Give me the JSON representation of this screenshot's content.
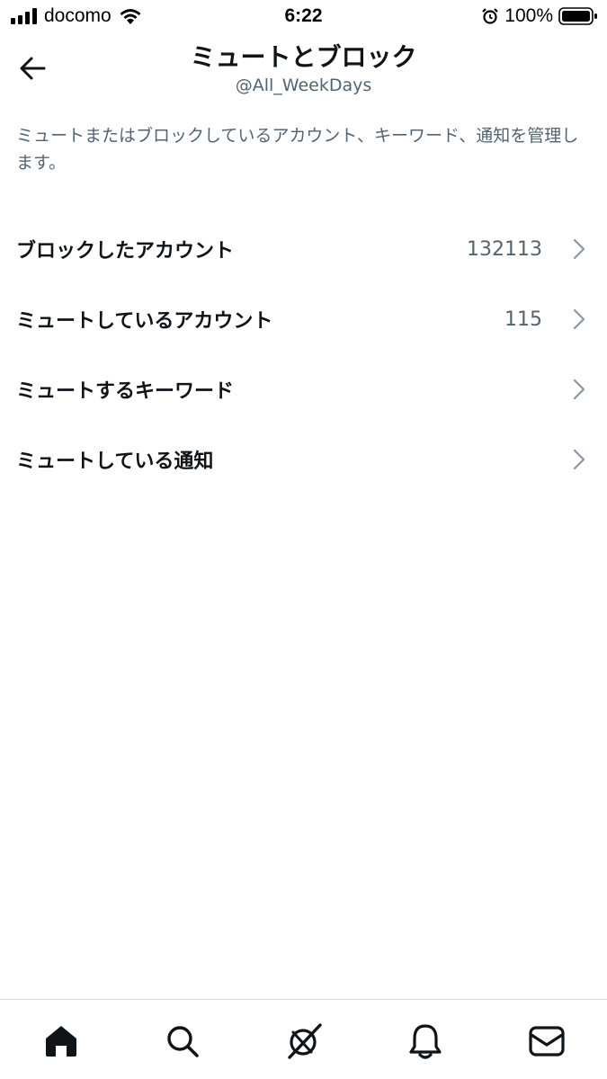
{
  "status_bar": {
    "carrier": "docomo",
    "time": "6:22",
    "battery": "100%"
  },
  "header": {
    "title": "ミュートとブロック",
    "subtitle": "@All_WeekDays"
  },
  "description": "ミュートまたはブロックしているアカウント、キーワード、通知を管理します。",
  "settings": [
    {
      "label": "ブロックしたアカウント",
      "count": "132113"
    },
    {
      "label": "ミュートしているアカウント",
      "count": "115"
    },
    {
      "label": "ミュートするキーワード",
      "count": ""
    },
    {
      "label": "ミュートしている通知",
      "count": ""
    }
  ],
  "bottom_nav": [
    "home-icon",
    "search-icon",
    "spaces-icon",
    "notifications-icon",
    "messages-icon"
  ],
  "colors": {
    "text_primary": "#0f1419",
    "text_secondary": "#536471",
    "chevron": "#8b98a5",
    "divider": "#cfd9de"
  }
}
